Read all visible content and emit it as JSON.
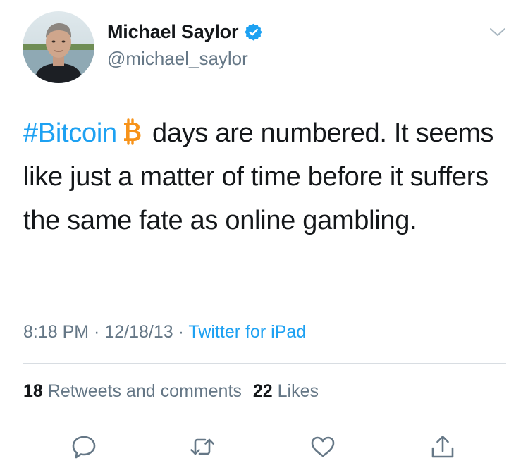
{
  "user": {
    "display_name": "Michael Saylor",
    "handle": "@michael_saylor"
  },
  "tweet": {
    "hashtag": "#Bitcoin",
    "text_after_hashtag": " days are numbered.  It seems like just a matter of time before it suffers the same fate as online gambling."
  },
  "meta": {
    "time": "8:18 PM",
    "separator": " · ",
    "date": "12/18/13",
    "source": "Twitter for iPad"
  },
  "stats": {
    "retweets_count": "18",
    "retweets_label": "Retweets and comments",
    "likes_count": "22",
    "likes_label": "Likes"
  },
  "icons": {
    "verified": "verified-badge-icon",
    "bitcoin": "bitcoin-icon",
    "more": "chevron-down-icon",
    "reply": "reply-icon",
    "retweet": "retweet-icon",
    "like": "heart-icon",
    "share": "share-icon"
  },
  "colors": {
    "accent": "#1da1f2",
    "bitcoin": "#f7931a",
    "text": "#14171a",
    "secondary": "#657786"
  }
}
